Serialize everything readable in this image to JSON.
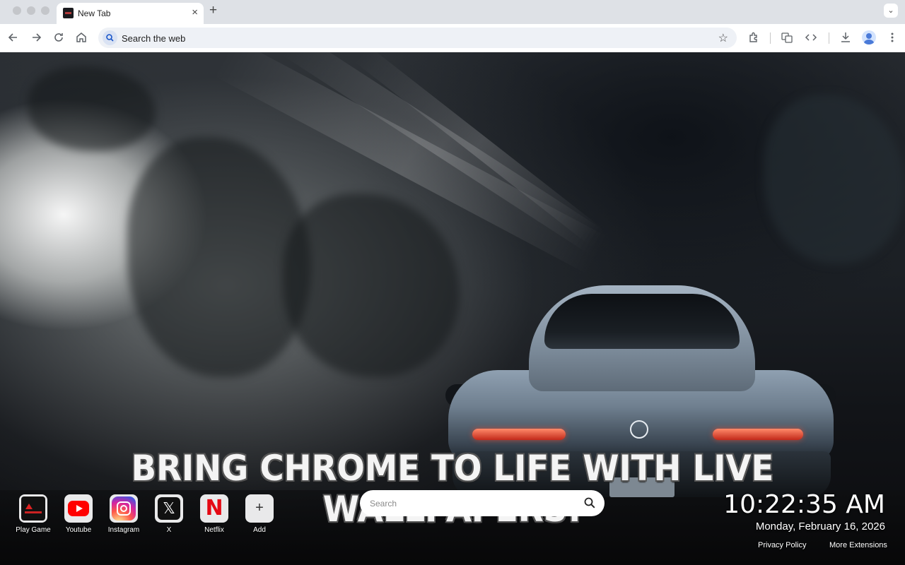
{
  "browser": {
    "tab": {
      "title": "New Tab",
      "close_glyph": "×"
    },
    "new_tab_glyph": "+",
    "tab_search_glyph": "⌄",
    "omnibox": {
      "placeholder": "Search the web"
    },
    "icons": [
      "back-icon",
      "forward-icon",
      "reload-icon",
      "home-icon",
      "star-icon",
      "extensions-icon",
      "translate-icon",
      "devtools-icon",
      "download-icon",
      "profile-icon",
      "menu-icon"
    ]
  },
  "page": {
    "headline": "BRING CHROME TO LIFE WITH LIVE WALLPAPERS!",
    "search": {
      "placeholder": "Search"
    },
    "shortcuts": [
      {
        "label": "Play Game",
        "icon": "game-logo-icon"
      },
      {
        "label": "Youtube",
        "icon": "youtube-icon"
      },
      {
        "label": "Instagram",
        "icon": "instagram-icon"
      },
      {
        "label": "X",
        "icon": "x-icon",
        "glyph": "𝕏"
      },
      {
        "label": "Netflix",
        "icon": "netflix-icon",
        "glyph": "N"
      },
      {
        "label": "Add",
        "icon": "plus-icon",
        "glyph": "+"
      }
    ],
    "clock": {
      "time": "10:22:35 AM",
      "date": "Monday, February 16, 2026"
    },
    "footer": {
      "privacy": "Privacy Policy",
      "more": "More Extensions"
    }
  },
  "colors": {
    "accent": "#1a73e8",
    "toolbar_bg": "#ffffff",
    "tabstrip_bg": "#dee1e6",
    "youtube": "#ff0000",
    "netflix": "#e50914"
  }
}
